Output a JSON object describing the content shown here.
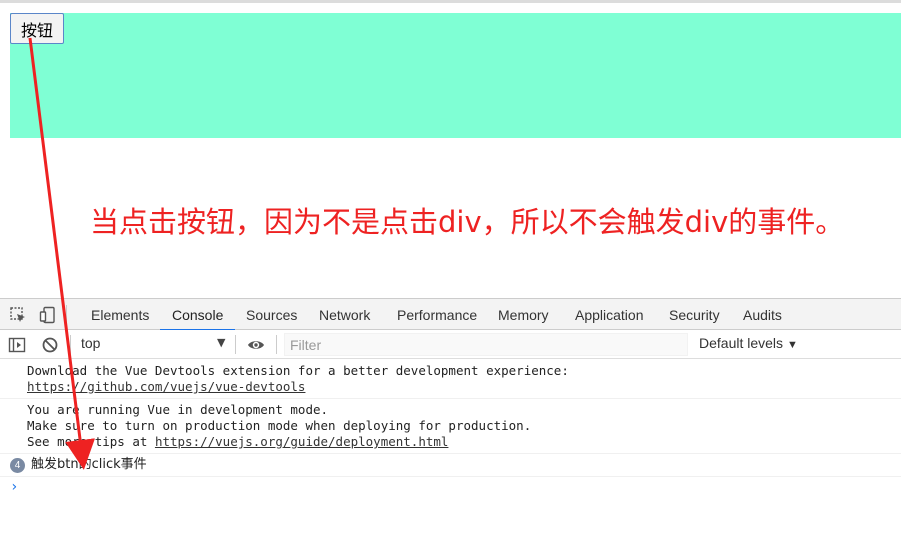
{
  "page": {
    "button_label": "按钮",
    "annotation_text": "当点击按钮，因为不是点击div，所以不会触发div的事件。",
    "div_color": "#7fffd4",
    "annotation_color": "#ee2222"
  },
  "devtools": {
    "tabs": [
      "Elements",
      "Console",
      "Sources",
      "Network",
      "Performance",
      "Memory",
      "Application",
      "Security",
      "Audits"
    ],
    "active_tab": "Console",
    "icons": [
      "inspect-element-icon",
      "device-toolbar-icon"
    ],
    "filter_bar": {
      "icons": [
        "sidebar-toggle-icon",
        "clear-console-icon",
        "eye-icon"
      ],
      "context": "top",
      "filter_placeholder": "Filter",
      "levels_label": "Default levels"
    },
    "console": {
      "messages": [
        {
          "line1": "Download the Vue Devtools extension for a better development experience:",
          "link": "https://github.com/vuejs/vue-devtools"
        },
        {
          "line1": "You are running Vue in development mode.",
          "line2": "Make sure to turn on production mode when deploying for production.",
          "line3_prefix": "See more tips at ",
          "link": "https://vuejs.org/guide/deployment.html"
        },
        {
          "count": "4",
          "text": "触发btn的click事件"
        }
      ],
      "prompt_symbol": "›"
    }
  }
}
